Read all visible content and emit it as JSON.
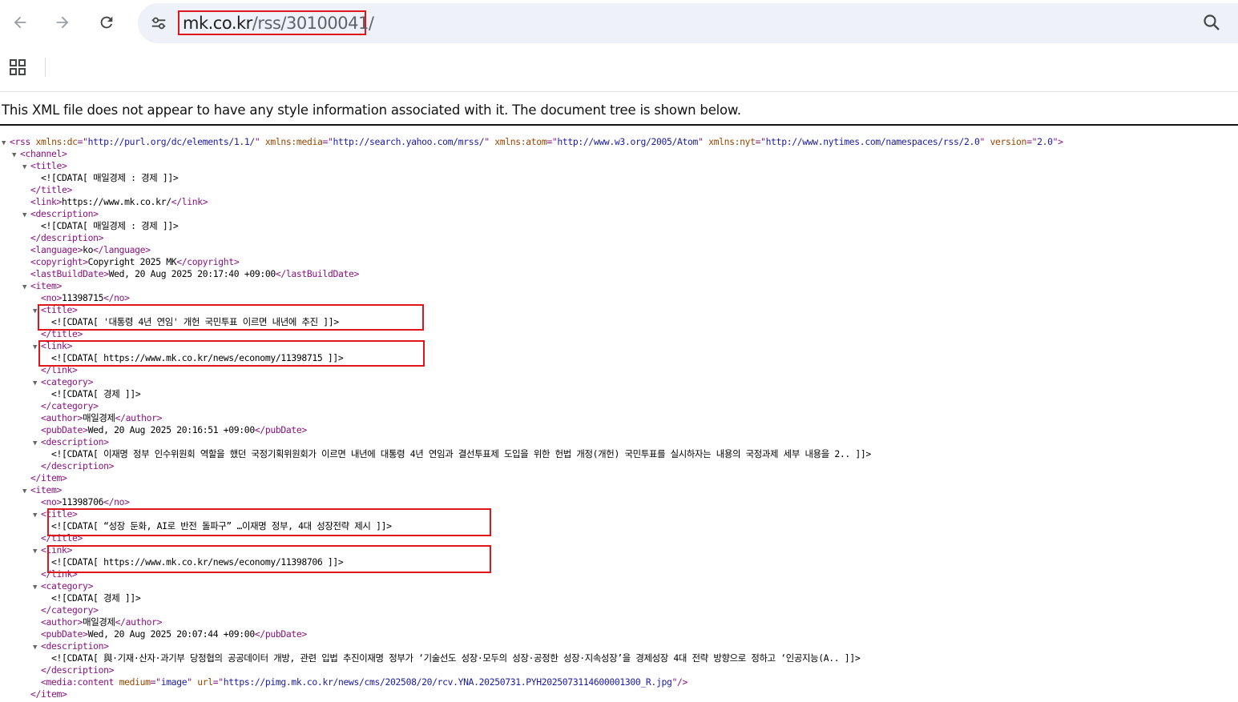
{
  "browser": {
    "url_host": "mk.co.kr",
    "url_path": "/rss/30100041/",
    "icons": {
      "back": "back-arrow-icon",
      "forward": "forward-arrow-icon",
      "reload": "reload-icon",
      "site_info": "tune-icon",
      "search": "search-icon",
      "apps": "apps-grid-icon"
    }
  },
  "notice": "This XML file does not appear to have any style information associated with it. The document tree is shown below.",
  "highlight_color": "#e0161b",
  "xml_lines": [
    {
      "indent": 0,
      "toggle": true,
      "segs": [
        [
          "tag",
          "<rss "
        ],
        [
          "attr",
          "xmlns:dc"
        ],
        [
          "tag",
          "=\""
        ],
        [
          "aval",
          "http://purl.org/dc/elements/1.1/"
        ],
        [
          "tag",
          "\" "
        ],
        [
          "attr",
          "xmlns:media"
        ],
        [
          "tag",
          "=\""
        ],
        [
          "aval",
          "http://search.yahoo.com/mrss/"
        ],
        [
          "tag",
          "\" "
        ],
        [
          "attr",
          "xmlns:atom"
        ],
        [
          "tag",
          "=\""
        ],
        [
          "aval",
          "http://www.w3.org/2005/Atom"
        ],
        [
          "tag",
          "\" "
        ],
        [
          "attr",
          "xmlns:nyt"
        ],
        [
          "tag",
          "=\""
        ],
        [
          "aval",
          "http://www.nytimes.com/namespaces/rss/2.0"
        ],
        [
          "tag",
          "\" "
        ],
        [
          "attr",
          "version"
        ],
        [
          "tag",
          "=\""
        ],
        [
          "aval",
          "2.0"
        ],
        [
          "tag",
          "\">"
        ]
      ]
    },
    {
      "indent": 1,
      "toggle": true,
      "segs": [
        [
          "tag",
          "<channel>"
        ]
      ]
    },
    {
      "indent": 2,
      "toggle": true,
      "segs": [
        [
          "tag",
          "<title>"
        ]
      ]
    },
    {
      "indent": 3,
      "toggle": false,
      "segs": [
        [
          "txt",
          "<![CDATA[ 매일경제 : 경제 ]]>"
        ]
      ]
    },
    {
      "indent": 2,
      "toggle": false,
      "segs": [
        [
          "tag",
          "</title>"
        ]
      ]
    },
    {
      "indent": 2,
      "toggle": false,
      "segs": [
        [
          "tag",
          "<link>"
        ],
        [
          "txt",
          "https://www.mk.co.kr/"
        ],
        [
          "tag",
          "</link>"
        ]
      ]
    },
    {
      "indent": 2,
      "toggle": true,
      "segs": [
        [
          "tag",
          "<description>"
        ]
      ]
    },
    {
      "indent": 3,
      "toggle": false,
      "segs": [
        [
          "txt",
          "<![CDATA[ 매일경제 : 경제 ]]>"
        ]
      ]
    },
    {
      "indent": 2,
      "toggle": false,
      "segs": [
        [
          "tag",
          "</description>"
        ]
      ]
    },
    {
      "indent": 2,
      "toggle": false,
      "segs": [
        [
          "tag",
          "<language>"
        ],
        [
          "txt",
          "ko"
        ],
        [
          "tag",
          "</language>"
        ]
      ]
    },
    {
      "indent": 2,
      "toggle": false,
      "segs": [
        [
          "tag",
          "<copyright>"
        ],
        [
          "txt",
          "Copyright 2025 MK"
        ],
        [
          "tag",
          "</copyright>"
        ]
      ]
    },
    {
      "indent": 2,
      "toggle": false,
      "segs": [
        [
          "tag",
          "<lastBuildDate>"
        ],
        [
          "txt",
          "Wed, 20 Aug 2025 20:17:40 +09:00"
        ],
        [
          "tag",
          "</lastBuildDate>"
        ]
      ]
    },
    {
      "indent": 2,
      "toggle": true,
      "segs": [
        [
          "tag",
          "<item>"
        ]
      ]
    },
    {
      "indent": 3,
      "toggle": false,
      "segs": [
        [
          "tag",
          "<no>"
        ],
        [
          "txt",
          "11398715"
        ],
        [
          "tag",
          "</no>"
        ]
      ]
    },
    {
      "indent": 3,
      "toggle": true,
      "segs": [
        [
          "tag",
          "<title>"
        ]
      ]
    },
    {
      "indent": 4,
      "toggle": false,
      "segs": [
        [
          "txt",
          "<![CDATA[ '대통령 4년 연임' 개헌 국민투표 이르면 내년에 추진 ]]>"
        ]
      ]
    },
    {
      "indent": 3,
      "toggle": false,
      "segs": [
        [
          "tag",
          "</title>"
        ]
      ]
    },
    {
      "indent": 3,
      "toggle": true,
      "segs": [
        [
          "tag",
          "<link>"
        ]
      ]
    },
    {
      "indent": 4,
      "toggle": false,
      "segs": [
        [
          "txt",
          "<![CDATA[ https://www.mk.co.kr/news/economy/11398715 ]]>"
        ]
      ]
    },
    {
      "indent": 3,
      "toggle": false,
      "segs": [
        [
          "tag",
          "</link>"
        ]
      ]
    },
    {
      "indent": 3,
      "toggle": true,
      "segs": [
        [
          "tag",
          "<category>"
        ]
      ]
    },
    {
      "indent": 4,
      "toggle": false,
      "segs": [
        [
          "txt",
          "<![CDATA[ 경제 ]]>"
        ]
      ]
    },
    {
      "indent": 3,
      "toggle": false,
      "segs": [
        [
          "tag",
          "</category>"
        ]
      ]
    },
    {
      "indent": 3,
      "toggle": false,
      "segs": [
        [
          "tag",
          "<author>"
        ],
        [
          "txt",
          "매일경제"
        ],
        [
          "tag",
          "</author>"
        ]
      ]
    },
    {
      "indent": 3,
      "toggle": false,
      "segs": [
        [
          "tag",
          "<pubDate>"
        ],
        [
          "txt",
          "Wed, 20 Aug 2025 20:16:51 +09:00"
        ],
        [
          "tag",
          "</pubDate>"
        ]
      ]
    },
    {
      "indent": 3,
      "toggle": true,
      "segs": [
        [
          "tag",
          "<description>"
        ]
      ]
    },
    {
      "indent": 4,
      "toggle": false,
      "segs": [
        [
          "txt",
          "<![CDATA[ 이재명 정부 인수위원회 역할을 했던 국정기획위원회가 이르면 내년에 대통령 4년 연임과 결선투표제 도입을 위한 헌법 개정(개헌) 국민투표를 실시하자는 내용의 국정과제 세부 내용을 2.. ]]>"
        ]
      ]
    },
    {
      "indent": 3,
      "toggle": false,
      "segs": [
        [
          "tag",
          "</description>"
        ]
      ]
    },
    {
      "indent": 2,
      "toggle": false,
      "segs": [
        [
          "tag",
          "</item>"
        ]
      ]
    },
    {
      "indent": 2,
      "toggle": true,
      "segs": [
        [
          "tag",
          "<item>"
        ]
      ]
    },
    {
      "indent": 3,
      "toggle": false,
      "segs": [
        [
          "tag",
          "<no>"
        ],
        [
          "txt",
          "11398706"
        ],
        [
          "tag",
          "</no>"
        ]
      ]
    },
    {
      "indent": 3,
      "toggle": true,
      "segs": [
        [
          "tag",
          "<title>"
        ]
      ]
    },
    {
      "indent": 4,
      "toggle": false,
      "segs": [
        [
          "txt",
          "<![CDATA[ “성장 둔화, AI로 반전 돌파구” …이재명 정부, 4대 성장전략 제시 ]]>"
        ]
      ]
    },
    {
      "indent": 3,
      "toggle": false,
      "segs": [
        [
          "tag",
          "</title>"
        ]
      ]
    },
    {
      "indent": 3,
      "toggle": true,
      "segs": [
        [
          "tag",
          "<link>"
        ]
      ]
    },
    {
      "indent": 4,
      "toggle": false,
      "segs": [
        [
          "txt",
          "<![CDATA[ https://www.mk.co.kr/news/economy/11398706 ]]>"
        ]
      ]
    },
    {
      "indent": 3,
      "toggle": false,
      "segs": [
        [
          "tag",
          "</link>"
        ]
      ]
    },
    {
      "indent": 3,
      "toggle": true,
      "segs": [
        [
          "tag",
          "<category>"
        ]
      ]
    },
    {
      "indent": 4,
      "toggle": false,
      "segs": [
        [
          "txt",
          "<![CDATA[ 경제 ]]>"
        ]
      ]
    },
    {
      "indent": 3,
      "toggle": false,
      "segs": [
        [
          "tag",
          "</category>"
        ]
      ]
    },
    {
      "indent": 3,
      "toggle": false,
      "segs": [
        [
          "tag",
          "<author>"
        ],
        [
          "txt",
          "매일경제"
        ],
        [
          "tag",
          "</author>"
        ]
      ]
    },
    {
      "indent": 3,
      "toggle": false,
      "segs": [
        [
          "tag",
          "<pubDate>"
        ],
        [
          "txt",
          "Wed, 20 Aug 2025 20:07:44 +09:00"
        ],
        [
          "tag",
          "</pubDate>"
        ]
      ]
    },
    {
      "indent": 3,
      "toggle": true,
      "segs": [
        [
          "tag",
          "<description>"
        ]
      ]
    },
    {
      "indent": 4,
      "toggle": false,
      "segs": [
        [
          "txt",
          "<![CDATA[ 與·기재·산자·과기부 당정협의 공공데이터 개방, 관련 입법 추진이재명 정부가 ‘기술선도 성장·모두의 성장·공정한 성장·지속성장’을 경제성장 4대 전략 방향으로 정하고 ‘인공지능(A.. ]]>"
        ]
      ]
    },
    {
      "indent": 3,
      "toggle": false,
      "segs": [
        [
          "tag",
          "</description>"
        ]
      ]
    },
    {
      "indent": 3,
      "toggle": false,
      "segs": [
        [
          "tag",
          "<media:content "
        ],
        [
          "attr",
          "medium"
        ],
        [
          "tag",
          "=\""
        ],
        [
          "aval",
          "image"
        ],
        [
          "tag",
          "\" "
        ],
        [
          "attr",
          "url"
        ],
        [
          "tag",
          "=\""
        ],
        [
          "aval",
          "https://pimg.mk.co.kr/news/cms/202508/20/rcv.YNA.20250731.PYH2025073114600001300_R.jpg"
        ],
        [
          "tag",
          "\"/>"
        ]
      ]
    },
    {
      "indent": 2,
      "toggle": false,
      "segs": [
        [
          "tag",
          "</item>"
        ]
      ]
    }
  ]
}
